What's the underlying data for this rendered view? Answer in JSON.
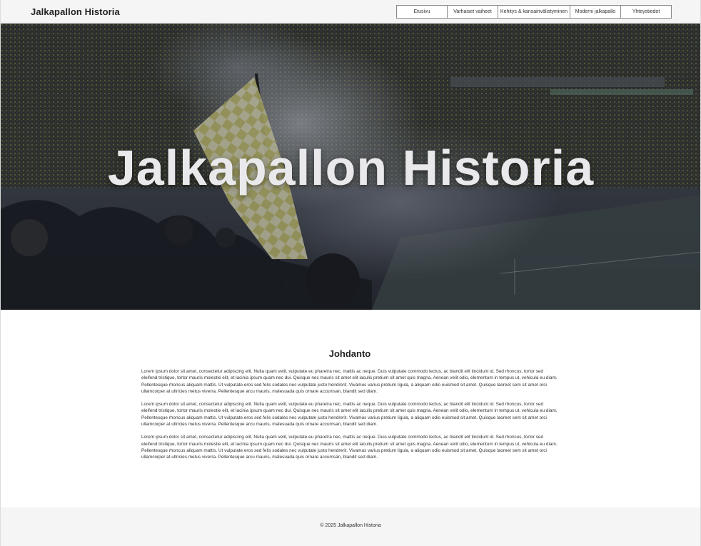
{
  "header": {
    "logo": "Jalkapallon Historia",
    "nav": [
      {
        "label": "Etusivu"
      },
      {
        "label": "Varhaiset vaiheet"
      },
      {
        "label": "Kehitys & kansainvälistyminen"
      },
      {
        "label": "Moderni jalkapallo"
      },
      {
        "label": "Yhteystiedot"
      }
    ]
  },
  "hero": {
    "title": "Jalkapallon Historia",
    "image": "stadium-crowd-flag-smoke"
  },
  "intro": {
    "heading": "Johdanto",
    "paragraphs": [
      "Lorem ipsum dolor sit amet, consectetur adipiscing elit. Nulla quam velit, vulputate eu pharetra nec, mattis ac neque. Duis vulputate commodo lectus, ac blandit elit tincidunt id. Sed rhoncus, tortor sed eleifend tristique, tortor mauris molestie elit, et lacinia ipsum quam nec dui. Quisque nec mauris sit amet elit iaculis pretium sit amet quis magna. Aenean velit odio, elementum in tempus ut, vehicula eu diam. Pellentesque rhoncus aliquam mattis. Ut vulputate eros sed felis sodales nec vulputate justo hendrerit. Vivamus varius pretium ligula, a aliquam odio euismod sit amet. Quisque laoreet sem sit amet orci ullamcorper at ultricies metus viverra. Pellentesque arcu mauris, malesuada quis ornare accumsan, blandit sed diam.",
      "Lorem ipsum dolor sit amet, consectetur adipiscing elit. Nulla quam velit, vulputate eu pharetra nec, mattis ac neque. Duis vulputate commodo lectus, ac blandit elit tincidunt id. Sed rhoncus, tortor sed eleifend tristique, tortor mauris molestie elit, et lacinia ipsum quam nec dui. Quisque nec mauris sit amet elit iaculis pretium sit amet quis magna. Aenean velit odio, elementum in tempus ut, vehicula eu diam. Pellentesque rhoncus aliquam mattis. Ut vulputate eros sed felis sodales nec vulputate justo hendrerit. Vivamus varius pretium ligula, a aliquam odio euismod sit amet. Quisque laoreet sem sit amet orci ullamcorper at ultricies metus viverra. Pellentesque arcu mauris, malesuada quis ornare accumsan, blandit sed diam.",
      "Lorem ipsum dolor sit amet, consectetur adipiscing elit. Nulla quam velit, vulputate eu pharetra nec, mattis ac neque. Duis vulputate commodo lectus, ac blandit elit tincidunt id. Sed rhoncus, tortor sed eleifend tristique, tortor mauris molestie elit, et lacinia ipsum quam nec dui. Quisque nec mauris sit amet elit iaculis pretium sit amet quis magna. Aenean velit odio, elementum in tempus ut, vehicula eu diam. Pellentesque rhoncus aliquam mattis. Ut vulputate eros sed felis sodales nec vulputate justo hendrerit. Vivamus varius pretium ligula, a aliquam odio euismod sit amet. Quisque laoreet sem sit amet orci ullamcorper at ultricies metus viverra. Pellentesque arcu mauris, malesuada quis ornare accumsan, blandit sed diam."
    ]
  },
  "footer": {
    "copyright": "© 2025 Jalkapallon Historia"
  },
  "colors": {
    "header_bg": "#f5f5f5",
    "footer_bg": "#f5f5f5",
    "hero_overlay": "#2a2d35",
    "flag_yellow": "#c9c46a"
  }
}
